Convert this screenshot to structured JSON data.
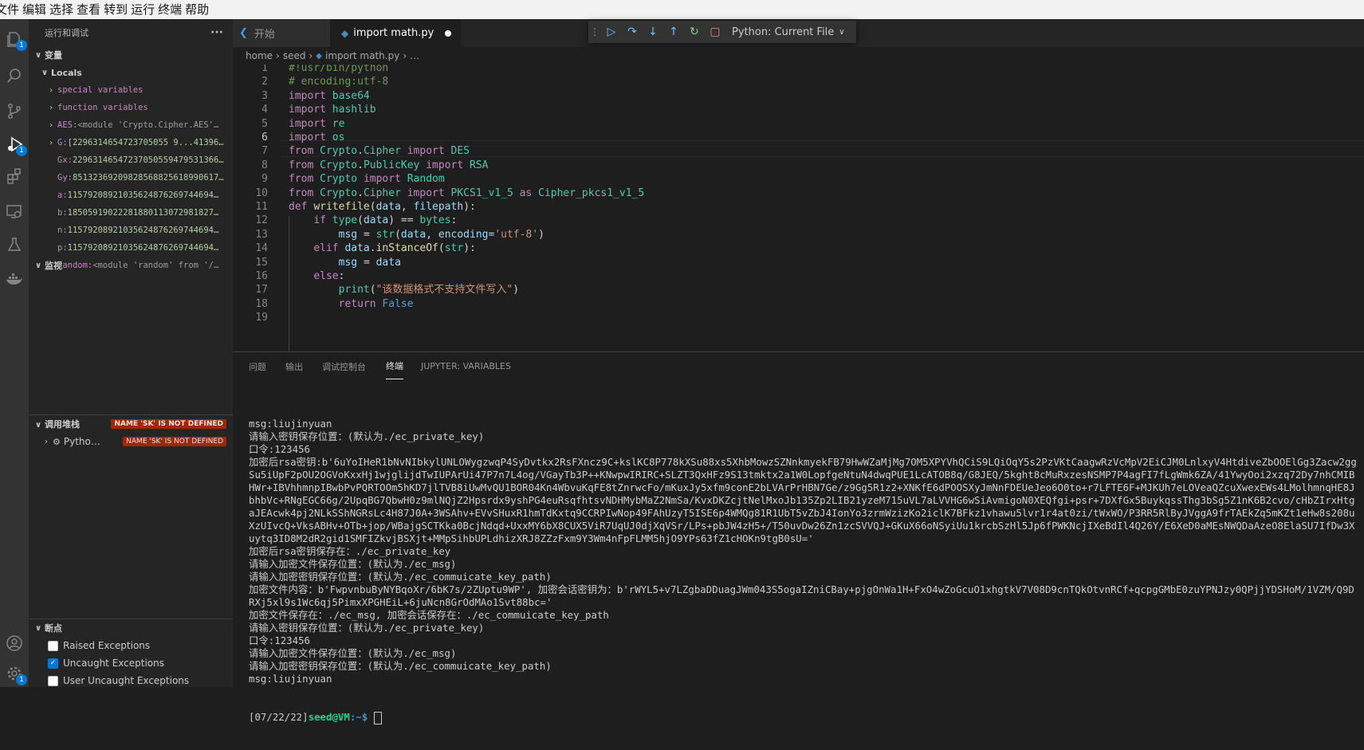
{
  "menu": [
    "文件",
    "编辑",
    "选择",
    "查看",
    "转到",
    "运行",
    "终端",
    "帮助"
  ],
  "activity_bar": {
    "explorer_badge": "1",
    "debug_badge": "1",
    "settings_badge": "1"
  },
  "sidebar": {
    "title": "运行和调试",
    "more": "···",
    "variables_header": "变量",
    "locals_header": "Locals",
    "variables": [
      {
        "name": "special variables",
        "value": "",
        "expandable": true
      },
      {
        "name": "function variables",
        "value": "",
        "expandable": true
      },
      {
        "name": "AES:",
        "value": "<module 'Crypto.Cipher.AES'…",
        "expandable": true
      },
      {
        "name": "G:",
        "value": "[2296314654723705055 9...41396…",
        "expandable": true
      },
      {
        "name": "Gx:",
        "value": "22963146547237050559479531366…",
        "expandable": false
      },
      {
        "name": "Gy:",
        "value": "85132369209828568825618990617…",
        "expandable": false
      },
      {
        "name": "a:",
        "value": "11579208921035624876269744694…",
        "expandable": false
      },
      {
        "name": "b:",
        "value": "18505919022281880113072981827…",
        "expandable": false
      },
      {
        "name": "n:",
        "value": "11579208921035624876269744694…",
        "expandable": false
      },
      {
        "name": "p:",
        "value": "11579208921035624876269744694…",
        "expandable": false
      },
      {
        "name": "random:",
        "value": "<module 'random' from '/…",
        "expandable": true
      }
    ],
    "watch_header": "监视",
    "callstack_header": "调用堆栈",
    "callstack_error": "NAME 'SK' IS NOT DEFINED",
    "callstack_item": "Pytho…",
    "callstack_item_error": "NAME 'SK' IS NOT DEFINED",
    "breakpoints_header": "断点",
    "breakpoints": [
      {
        "label": "Raised Exceptions",
        "checked": false
      },
      {
        "label": "Uncaught Exceptions",
        "checked": true
      },
      {
        "label": "User Uncaught Exceptions",
        "checked": false
      }
    ]
  },
  "tabs": [
    {
      "label": "开始",
      "active": false
    },
    {
      "label": "import math.py",
      "active": true,
      "dirty": true
    }
  ],
  "debug_toolbar": {
    "config": "Python: Current File"
  },
  "breadcrumb": [
    "home",
    "seed",
    "import math.py",
    "…"
  ],
  "editor": {
    "current_line": 6,
    "lines": [
      "#!usr/bin/python",
      "# encoding:utf-8",
      "import base64",
      "import hashlib",
      "import re",
      "import os",
      "from Crypto.Cipher import DES",
      "from Crypto.PublicKey import RSA",
      "from Crypto import Random",
      "from Crypto.Cipher import PKCS1_v1_5 as Cipher_pkcs1_v1_5",
      "def writefile(data, filepath):",
      "    if type(data) == bytes:",
      "        msg = str(data, encoding='utf-8')",
      "    elif data.inStanceOf(str):",
      "        msg = data",
      "    else:",
      "        print(\"该数据格式不支持文件写入\")",
      "        return False",
      ""
    ]
  },
  "panel": {
    "tabs": [
      "问题",
      "输出",
      "调试控制台",
      "终端",
      "JUPYTER: VARIABLES"
    ],
    "active_tab": "终端",
    "terminal_lines": [
      "msg:liujinyuan",
      "请输入密钥保存位置：(默认为./ec_private_key)",
      "口令:123456",
      "加密后rsa密钥:b'6uYoIHeR1bNvNIbkylUNLOWygzwqP4SyDvtkx2RsFXncz9C+kslKC8P778kXSu88xs5XhbMowzSZNnkmyekFB79HwWZaMjMg7OM5XPYVhQCiS9LQiOqY5s2PzVKtCaagwRzVcMpV2EiCJM0LnlxyV4HtdiveZbOOElGg3Zacw2ggSu5iUpF2pOU2OGVoKxxHj1wjglijdTwIUPArUi47P7n7L4og/VGayTb3P++KNwpwIRIRC+SLZT3QxHFz9S13tmktx2a1W0LopfgeNtuN4dwqPUE1LcATOB8q/G8JEQ/5kght8cMuRxzesNSMP7P4agFI7fLgWmk6ZA/41YwyOoi2xzq72Dy7nhCMIBHWr+IBVhhmnpIBwbPvPQRTOOm5hKD7jlTVB8iUwMvQU1BOR04Kn4WbvuKqFE8tZnrwcFo/mKuxJy5xfm9conE2bLVArPrHBN7Ge/z9Gg5R1z2+XNKfE6dPOOSXyJmNnFDEUeJeo6O0to+r7LFTE6F+MJKUh7eLOVeaQZcuXwexEWs4LMolhmnqHE8JbhbVc+RNgEGC66g/2UpqBG7QbwH0z9mlNQjZ2Hpsrdx9yshPG4euRsqfhtsvNDHMybMaZ2NmSa/KvxDKZcjtNelMxoJb135Zp2LIB21yzeM715uVL7aLVVHG6wSiAvmigoN0XEQfgi+psr+7DXfGx5BuykqssThg3bSg5Z1nK6B2cvo/cHbZIrxHtgaJEAcwk4pj2NLkSShNGRsLc4H87J0A+3WSAhv+EVvSHuxR1hmTdKxtq9CCRPIwNop49FAhUzyT5ISE6p4WMQg81R1UbT5vZbJ4IonYo3zrmWzizKo2iclK7BFkz1vhawu5lvr1r4at0zi/tWxWO/P3RR5RlByJVggA9frTAEkZq5mKZt1eHw8s208uXzUIvcQ+VksABHv+OTb+jop/WBajgSCTKka0BcjNdqd+UxxMY6bX8CUX5ViR7UqUJ0djXqVSr/LPs+pbJW4zH5+/T50uvDw26Zn1zcSVVQJ+GKuX66oNSyiUu1krcbSzHl5Jp6fPWKNcjIXeBdIl4Q26Y/E6XeD0aMEsNWQDaAzeO8ElaSU7IfDw3Xuytq3ID8M2dR2gid1SMFIZkvjBSXjt+MMpSihbUPLdhizXRJ8ZZzFxm9Y3Wm4nFpFLMM5hjO9YPs63fZ1cHOKn9tgB0sU='",
      "加密后rsa密钥保存在：./ec_private_key",
      "请输入加密文件保存位置：(默认为./ec_msg)",
      "请输入加密密钥保存位置：(默认为./ec_commuicate_key_path)",
      "加密文件内容：b'FwpvnbuByNYBqoXr/6bK7s/2ZUptu9WP', 加密会话密钥为：b'rWYL5+v7LZgbaDDuagJWm043S5ogaIZniCBay+pjgOnWa1H+FxO4wZoGcuO1xhgtkV7V08D9cnTQkOtvnRCf+qcpgGMbE0zuYPNJzy0QPjjYDSHoM/1VZM/Q9DRXj5xl9s1Wc6qj5PimxXPGHEiL+6juNcn8GrOdMAo1Svt88bc='",
      "加密文件保存在：./ec_msg, 加密会话保存在：./ec_commuicate_key_path",
      "请输入密钥保存位置：(默认为./ec_private_key)",
      "口令:123456",
      "请输入加密文件保存位置：(默认为./ec_msg)",
      "请输入加密密钥保存位置：(默认为./ec_commuicate_key_path)",
      "msg:liujinyuan"
    ],
    "prompt": {
      "time": "[07/22/22]",
      "user": "seed@VM",
      "path": ":~$"
    }
  }
}
